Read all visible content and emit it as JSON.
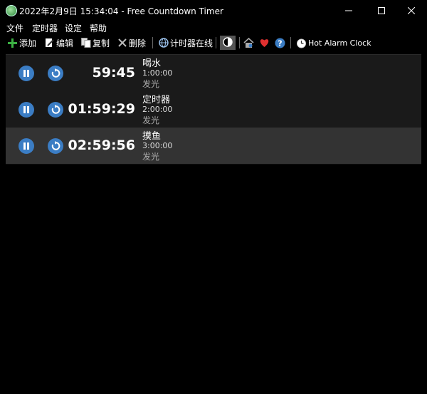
{
  "window": {
    "title": "2022年2月9日 15:34:04 - Free Countdown Timer",
    "icon": "app-clock-icon"
  },
  "menu": [
    "文件",
    "定时器",
    "设定",
    "帮助"
  ],
  "toolbar": {
    "add": "添加",
    "edit": "编辑",
    "copy": "复制",
    "delete": "删除",
    "online": "计时器在线",
    "hot_alarm": "Hot Alarm Clock"
  },
  "timers": [
    {
      "remaining": "59:45",
      "name": "喝水",
      "duration": "1:00:00",
      "sound": "发光"
    },
    {
      "remaining": "01:59:29",
      "name": "定时器",
      "duration": "2:00:00",
      "sound": "发光"
    },
    {
      "remaining": "02:59:56",
      "name": "摸鱼",
      "duration": "3:00:00",
      "sound": "发光"
    }
  ],
  "colors": {
    "accent": "#3b7dc4",
    "add_green": "#3cb043",
    "heart": "#e03030"
  }
}
